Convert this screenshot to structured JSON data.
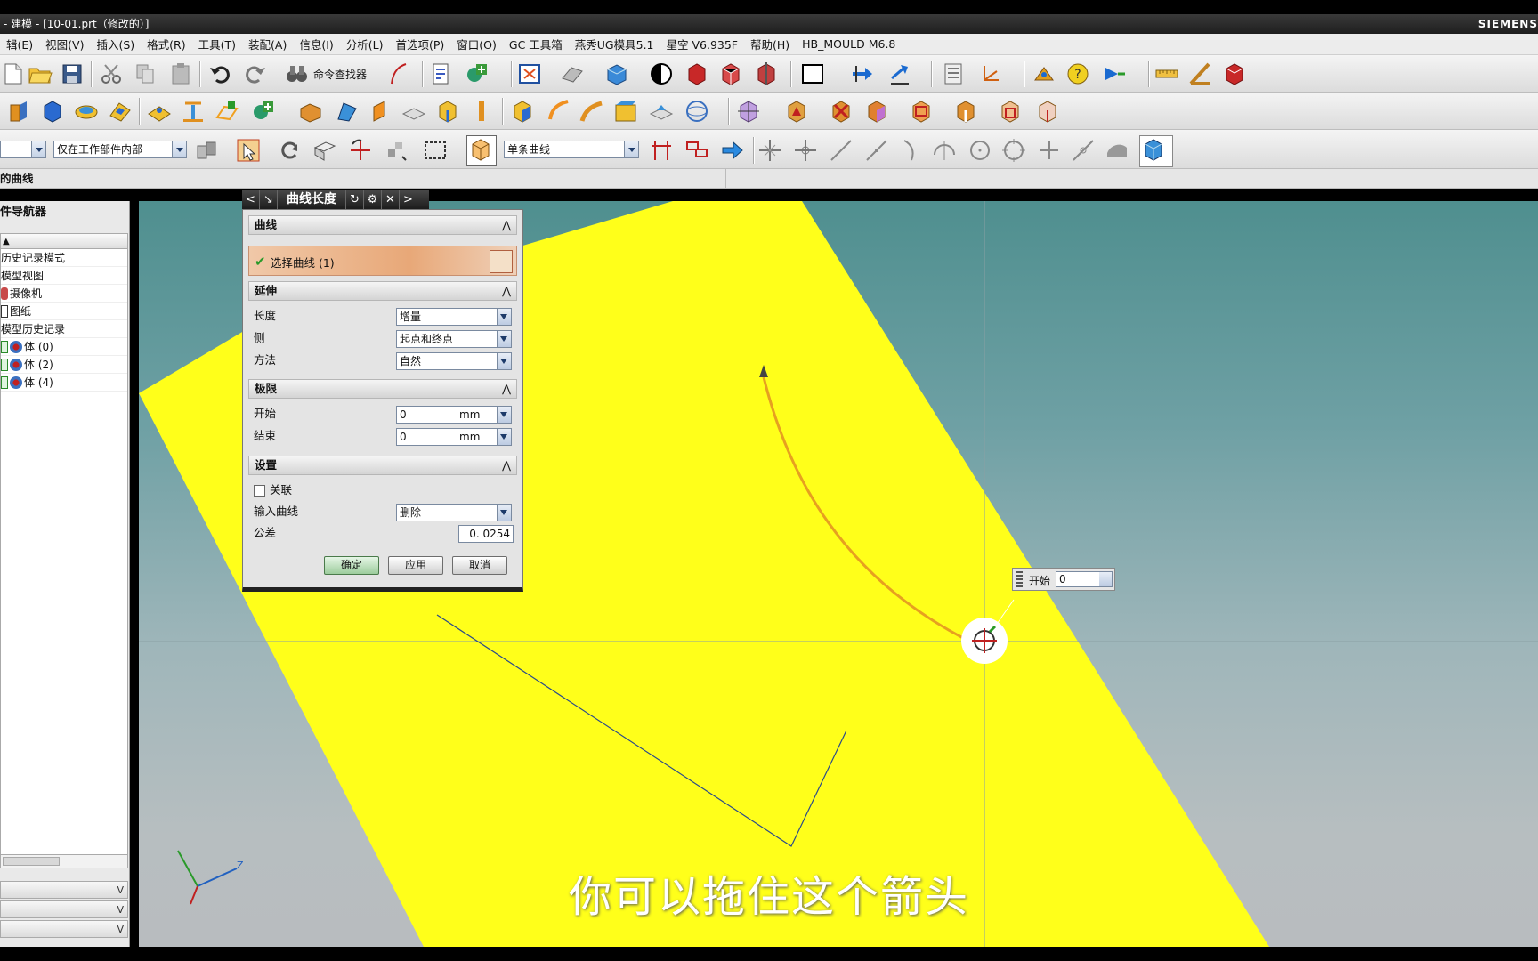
{
  "titlebar": {
    "title": "- 建模 - [10-01.prt（修改的）]",
    "brand": "SIEMENS"
  },
  "menu": [
    "辑(E)",
    "视图(V)",
    "插入(S)",
    "格式(R)",
    "工具(T)",
    "装配(A)",
    "信息(I)",
    "分析(L)",
    "首选项(P)",
    "窗口(O)",
    "GC 工具箱",
    "燕秀UG模具5.1",
    "星空 V6.935F",
    "帮助(H)",
    "HB_MOULD M6.8"
  ],
  "toolbar": {
    "command_finder": "命令查找器"
  },
  "selection_bar": {
    "filter_scope": "仅在工作部件内部",
    "curve_rule": "单条曲线",
    "cue": "的曲线"
  },
  "navigator": {
    "title": "件导航器",
    "items": [
      "历史记录模式",
      "模型视图",
      "摄像机",
      "图纸",
      "模型历史记录",
      "体 (0)",
      "体 (2)",
      "体 (4)"
    ]
  },
  "dialog": {
    "title": "曲线长度",
    "curve_group": "曲线",
    "select_curve": "选择曲线 (1)",
    "extend_group": "延伸",
    "length_label": "长度",
    "length_value": "增量",
    "side_label": "侧",
    "side_value": "起点和终点",
    "method_label": "方法",
    "method_value": "自然",
    "limits_group": "极限",
    "start_label": "开始",
    "start_value": "0",
    "start_unit": "mm",
    "end_label": "结束",
    "end_value": "0",
    "end_unit": "mm",
    "settings_group": "设置",
    "assoc_label": "关联",
    "input_curve_label": "输入曲线",
    "input_curve_value": "删除",
    "tolerance_label": "公差",
    "tolerance_value": "0. 0254",
    "ok": "确定",
    "apply": "应用",
    "cancel": "取消"
  },
  "onscreen_input": {
    "label": "开始",
    "value": "0"
  },
  "subtitle": "你可以拖住这个箭头",
  "triad": {
    "z_label": "Z"
  },
  "colors": {
    "sheet": "#ffff1a",
    "curve": "#e6a020",
    "dialog_select": "#e8a878"
  }
}
